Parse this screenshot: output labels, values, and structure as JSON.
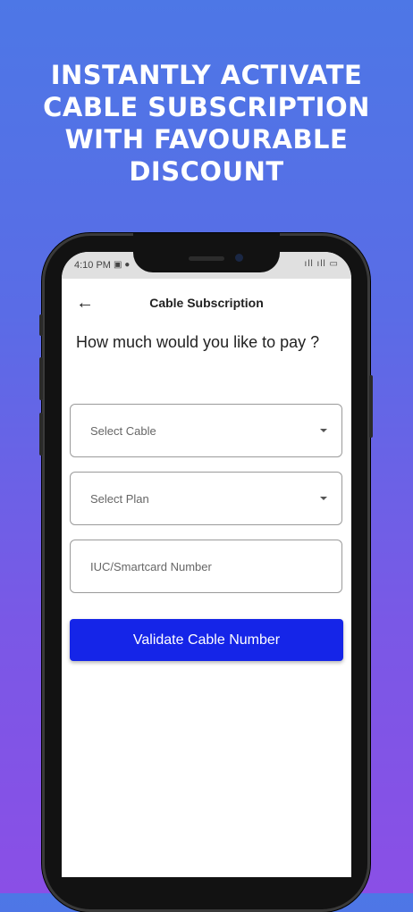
{
  "promo": {
    "headline_lines": [
      "INSTANTLY ACTIVATE",
      "CABLE SUBSCRIPTION",
      "WITH FAVOURABLE",
      "DISCOUNT"
    ]
  },
  "status_bar": {
    "time": "4:10 PM",
    "left_icons": "▣ ●",
    "right_icons": "ıll ıll ▭"
  },
  "app_bar": {
    "back_icon": "←",
    "title": "Cable Subscription"
  },
  "question": "How much would you like to pay ?",
  "form": {
    "select_cable_placeholder": "Select Cable",
    "select_plan_placeholder": "Select Plan",
    "iuc_placeholder": "IUC/Smartcard Number"
  },
  "validate_button": "Validate Cable Number",
  "colors": {
    "primary_button": "#1525e8",
    "bg_top": "#4d77e6",
    "bg_bottom": "#8a4fe6"
  }
}
